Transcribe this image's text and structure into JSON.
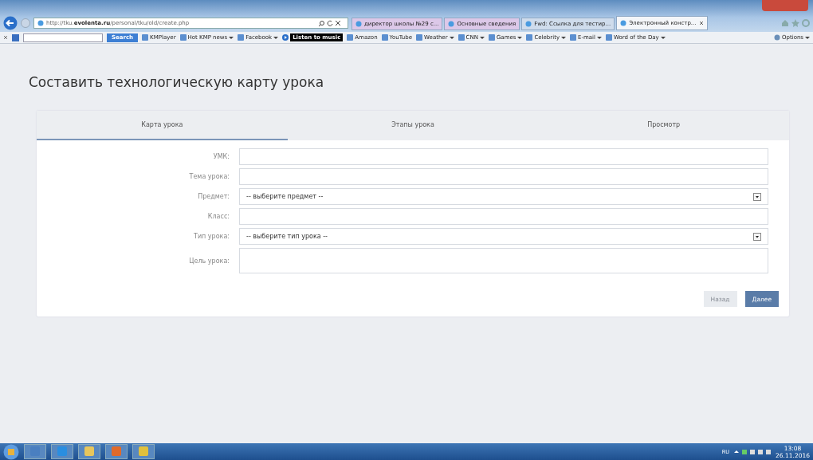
{
  "browser": {
    "address": "http://tku.**evolenta.ru**/personal/tku/old/create.php",
    "tabs": [
      {
        "label": "директор школы №29 с...",
        "selected": false,
        "color": "#dcc8e8"
      },
      {
        "label": "Основные сведения",
        "selected": false,
        "color": "#dcc8e8"
      },
      {
        "label": "Fwd: Ссылка для тестир...",
        "selected": false,
        "color": "#cfdcec"
      },
      {
        "label": "Электронный констр...",
        "selected": true,
        "color": "#f4f6f9"
      }
    ],
    "search_button": "Search",
    "bookmarks": [
      {
        "label": "KMPlayer",
        "dropdown": false
      },
      {
        "label": "Hot KMP news",
        "dropdown": true
      },
      {
        "label": "Facebook",
        "dropdown": true
      },
      {
        "label": "Listen to music",
        "dropdown": false
      },
      {
        "label": "Amazon",
        "dropdown": false
      },
      {
        "label": "YouTube",
        "dropdown": false
      },
      {
        "label": "Weather",
        "dropdown": true
      },
      {
        "label": "CNN",
        "dropdown": true
      },
      {
        "label": "Games",
        "dropdown": true
      },
      {
        "label": "Celebrity",
        "dropdown": true
      },
      {
        "label": "E-mail",
        "dropdown": true
      },
      {
        "label": "Word of the Day",
        "dropdown": true
      }
    ],
    "options": "Options"
  },
  "page": {
    "title": "Составить технологическую карту урока",
    "tabs": [
      {
        "label": "Карта урока",
        "selected": true
      },
      {
        "label": "Этапы урока",
        "selected": false
      },
      {
        "label": "Просмотр",
        "selected": false
      }
    ],
    "fields": [
      {
        "kind": "input",
        "label": "УМК:"
      },
      {
        "kind": "input",
        "label": "Тема урока:"
      },
      {
        "kind": "select",
        "label": "Предмет:",
        "value": "-- выберите предмет --"
      },
      {
        "kind": "input",
        "label": "Класс:"
      },
      {
        "kind": "select",
        "label": "Тип урока:",
        "value": "-- выберите тип урока --"
      },
      {
        "kind": "textarea",
        "label": "Цель урока:"
      }
    ],
    "buttons": [
      {
        "label": "Назад",
        "disabled": true
      },
      {
        "label": "Далее",
        "disabled": false
      }
    ]
  },
  "taskbar": {
    "language": "RU",
    "time": "13:08",
    "date": "26.11.2016"
  }
}
